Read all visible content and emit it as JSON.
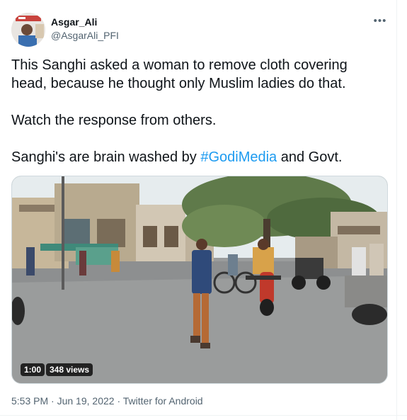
{
  "author": {
    "name": "Asgar_Ali",
    "handle": "@AsgarAli_PFI",
    "avatar_icon": "profile-photo"
  },
  "menu": {
    "more_label": "•••"
  },
  "tweet": {
    "line1": "This Sanghi asked a woman to remove cloth covering head, because he thought only Muslim ladies do that.",
    "line2": "Watch the response from others.",
    "line3_before": "Sanghi's are brain washed by ",
    "line3_hashtag": "#GodiMedia",
    "line3_after": " and Govt."
  },
  "video": {
    "duration": "1:00",
    "views": "348 views"
  },
  "footer": {
    "time": "5:53 PM",
    "separator1": " · ",
    "date": "Jun 19, 2022",
    "separator2": " · ",
    "source": "Twitter for Android"
  },
  "colors": {
    "accent": "#1d9bf0",
    "text": "#0f1419",
    "secondary": "#536471"
  }
}
